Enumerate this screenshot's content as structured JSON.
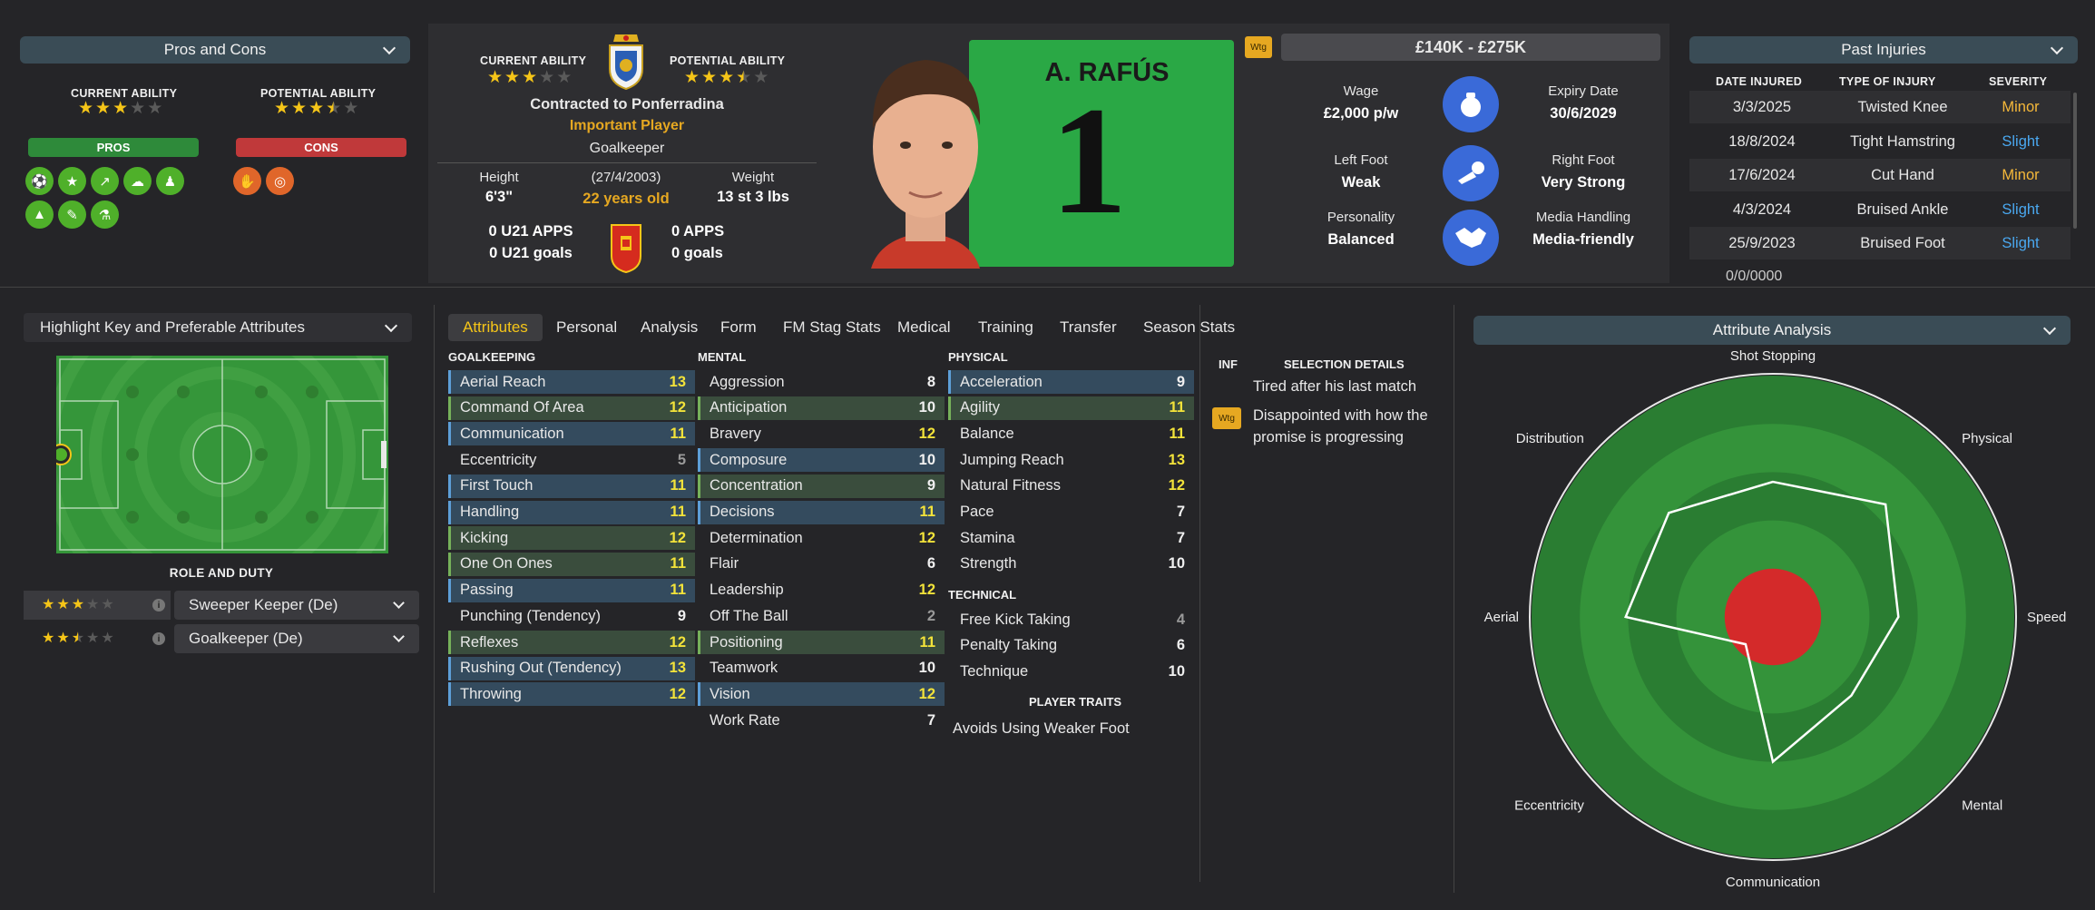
{
  "pros_cons": {
    "header": "Pros and Cons",
    "current_ability_label": "CURRENT ABILITY",
    "current_ability_stars": 3,
    "potential_ability_label": "POTENTIAL ABILITY",
    "potential_ability_stars": 3.5,
    "pros_label": "PROS",
    "cons_label": "CONS",
    "pros_icons": [
      "ball-icon",
      "star-icon",
      "trend-icon",
      "brain-icon",
      "team-icon",
      "cone-icon",
      "notepad-icon",
      "flask-icon"
    ],
    "cons_icons": [
      "foot-icon",
      "cone-target-icon"
    ]
  },
  "player": {
    "current_ability_label": "CURRENT ABILITY",
    "current_ability_stars": 3,
    "potential_ability_label": "POTENTIAL ABILITY",
    "potential_ability_stars": 3.5,
    "contract": "Contracted to Ponferradina",
    "status": "Important Player",
    "position": "Goalkeeper",
    "height_label": "Height",
    "height": "6'3\"",
    "dob": "(27/4/2003)",
    "age": "22 years old",
    "weight_label": "Weight",
    "weight": "13 st 3 lbs",
    "u21_apps": "0 U21 APPS",
    "u21_goals": "0 U21 goals",
    "apps": "0 APPS",
    "goals": "0 goals",
    "name": "A. RAFÚS",
    "shirt_number": "1"
  },
  "contract": {
    "wtg": "Wtg",
    "value_range": "£140K - £275K",
    "wage_label": "Wage",
    "wage": "£2,000 p/w",
    "expiry_label": "Expiry Date",
    "expiry": "30/6/2029",
    "left_foot_label": "Left Foot",
    "left_foot": "Weak",
    "right_foot_label": "Right Foot",
    "right_foot": "Very Strong",
    "personality_label": "Personality",
    "personality": "Balanced",
    "media_label": "Media Handling",
    "media": "Media-friendly"
  },
  "injuries": {
    "header": "Past Injuries",
    "col_date": "DATE INJURED",
    "col_type": "TYPE OF INJURY",
    "col_severity": "SEVERITY",
    "rows": [
      {
        "date": "3/3/2025",
        "type": "Twisted Knee",
        "severity": "Minor",
        "color": "#f5b83a"
      },
      {
        "date": "18/8/2024",
        "type": "Tight Hamstring",
        "severity": "Slight",
        "color": "#4aa8f0"
      },
      {
        "date": "17/6/2024",
        "type": "Cut Hand",
        "severity": "Minor",
        "color": "#f5b83a"
      },
      {
        "date": "4/3/2024",
        "type": "Bruised Ankle",
        "severity": "Slight",
        "color": "#4aa8f0"
      },
      {
        "date": "25/9/2023",
        "type": "Bruised Foot",
        "severity": "Slight",
        "color": "#4aa8f0"
      }
    ]
  },
  "highlight": {
    "header": "Highlight Key and Preferable Attributes",
    "role_duty_label": "ROLE AND DUTY",
    "roles": [
      {
        "name": "Sweeper Keeper (De)",
        "stars": 3
      },
      {
        "name": "Goalkeeper (De)",
        "stars": 2.5
      }
    ]
  },
  "tabs": [
    "Attributes",
    "Personal",
    "Analysis",
    "Form",
    "FM Stag Stats",
    "Medical",
    "Training",
    "Transfer",
    "Season Stats"
  ],
  "attributes": {
    "goalkeeping_label": "GOALKEEPING",
    "goalkeeping": [
      {
        "name": "Aerial Reach",
        "value": "13",
        "hl": "blue",
        "c": "y"
      },
      {
        "name": "Command Of Area",
        "value": "12",
        "hl": "green",
        "c": "y"
      },
      {
        "name": "Communication",
        "value": "11",
        "hl": "blue",
        "c": "y"
      },
      {
        "name": "Eccentricity",
        "value": "5",
        "hl": "",
        "c": "g"
      },
      {
        "name": "First Touch",
        "value": "11",
        "hl": "blue",
        "c": "y"
      },
      {
        "name": "Handling",
        "value": "11",
        "hl": "blue",
        "c": "y"
      },
      {
        "name": "Kicking",
        "value": "12",
        "hl": "green",
        "c": "y"
      },
      {
        "name": "One On Ones",
        "value": "11",
        "hl": "green",
        "c": "y"
      },
      {
        "name": "Passing",
        "value": "11",
        "hl": "blue",
        "c": "y"
      },
      {
        "name": "Punching (Tendency)",
        "value": "9",
        "hl": "",
        "c": "w"
      },
      {
        "name": "Reflexes",
        "value": "12",
        "hl": "green",
        "c": "y"
      },
      {
        "name": "Rushing Out (Tendency)",
        "value": "13",
        "hl": "blue",
        "c": "y"
      },
      {
        "name": "Throwing",
        "value": "12",
        "hl": "blue",
        "c": "y"
      }
    ],
    "mental_label": "MENTAL",
    "mental": [
      {
        "name": "Aggression",
        "value": "8",
        "hl": "",
        "c": "w"
      },
      {
        "name": "Anticipation",
        "value": "10",
        "hl": "green",
        "c": "w"
      },
      {
        "name": "Bravery",
        "value": "12",
        "hl": "",
        "c": "y"
      },
      {
        "name": "Composure",
        "value": "10",
        "hl": "blue",
        "c": "w"
      },
      {
        "name": "Concentration",
        "value": "9",
        "hl": "green",
        "c": "w"
      },
      {
        "name": "Decisions",
        "value": "11",
        "hl": "blue",
        "c": "y"
      },
      {
        "name": "Determination",
        "value": "12",
        "hl": "",
        "c": "y"
      },
      {
        "name": "Flair",
        "value": "6",
        "hl": "",
        "c": "w"
      },
      {
        "name": "Leadership",
        "value": "12",
        "hl": "",
        "c": "y"
      },
      {
        "name": "Off The Ball",
        "value": "2",
        "hl": "",
        "c": "g"
      },
      {
        "name": "Positioning",
        "value": "11",
        "hl": "green",
        "c": "y"
      },
      {
        "name": "Teamwork",
        "value": "10",
        "hl": "",
        "c": "w"
      },
      {
        "name": "Vision",
        "value": "12",
        "hl": "blue",
        "c": "y"
      },
      {
        "name": "Work Rate",
        "value": "7",
        "hl": "",
        "c": "w"
      }
    ],
    "physical_label": "PHYSICAL",
    "physical": [
      {
        "name": "Acceleration",
        "value": "9",
        "hl": "blue",
        "c": "w"
      },
      {
        "name": "Agility",
        "value": "11",
        "hl": "green",
        "c": "y"
      },
      {
        "name": "Balance",
        "value": "11",
        "hl": "",
        "c": "y"
      },
      {
        "name": "Jumping Reach",
        "value": "13",
        "hl": "",
        "c": "y"
      },
      {
        "name": "Natural Fitness",
        "value": "12",
        "hl": "",
        "c": "y"
      },
      {
        "name": "Pace",
        "value": "7",
        "hl": "",
        "c": "w"
      },
      {
        "name": "Stamina",
        "value": "7",
        "hl": "",
        "c": "w"
      },
      {
        "name": "Strength",
        "value": "10",
        "hl": "",
        "c": "w"
      }
    ],
    "technical_label": "TECHNICAL",
    "technical": [
      {
        "name": "Free Kick Taking",
        "value": "4",
        "hl": "",
        "c": "g"
      },
      {
        "name": "Penalty Taking",
        "value": "6",
        "hl": "",
        "c": "w"
      },
      {
        "name": "Technique",
        "value": "10",
        "hl": "",
        "c": "w"
      }
    ],
    "traits_label": "PLAYER TRAITS",
    "traits": [
      "Avoids Using Weaker Foot"
    ]
  },
  "selection": {
    "inf_label": "INF",
    "header": "SELECTION DETAILS",
    "line1": "Tired after his last match",
    "wtg": "Wtg",
    "line2": "Disappointed with how the",
    "line3": "promise is progressing"
  },
  "analysis": {
    "header": "Attribute Analysis",
    "chart_data": {
      "type": "radar",
      "axes": [
        "Shot Stopping",
        "Physical",
        "Speed",
        "Mental",
        "Communication",
        "Eccentricity",
        "Aerial",
        "Distribution"
      ],
      "values": [
        0.56,
        0.66,
        0.52,
        0.46,
        0.6,
        0.16,
        0.61,
        0.61
      ],
      "colors": {
        "bands": [
          "#2a7d32",
          "#34933a",
          "#2a7d32",
          "#34933a",
          "#2a7d32"
        ],
        "center": "#d42a2a"
      }
    }
  }
}
